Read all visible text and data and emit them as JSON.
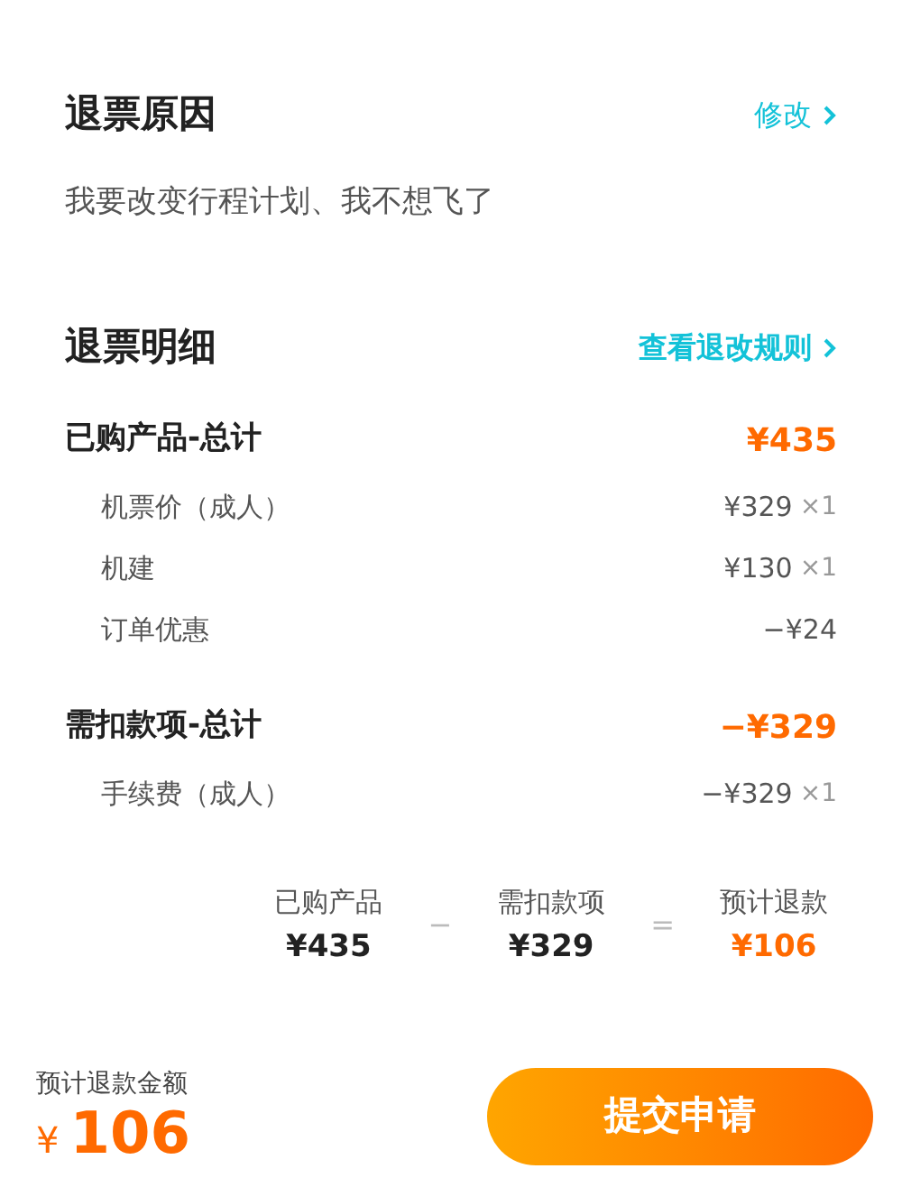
{
  "reason": {
    "title": "退票原因",
    "action": "修改",
    "text": "我要改变行程计划、我不想飞了"
  },
  "details": {
    "title": "退票明细",
    "action": "查看退改规则"
  },
  "groups": [
    {
      "title": "已购产品-总计",
      "total": "¥435",
      "items": [
        {
          "label": "机票价（成人）",
          "amount": "¥329",
          "qty": "×1"
        },
        {
          "label": "机建",
          "amount": "¥130",
          "qty": "×1"
        },
        {
          "label": "订单优惠",
          "amount": "−¥24"
        }
      ]
    },
    {
      "title": "需扣款项-总计",
      "total": "−¥329",
      "items": [
        {
          "label": "手续费（成人）",
          "amount": "−¥329",
          "qty": "×1"
        }
      ]
    }
  ],
  "formula": [
    {
      "kind": "term",
      "label": "已购产品",
      "value": "¥435",
      "highlight": false
    },
    {
      "kind": "op",
      "symbol": "−"
    },
    {
      "kind": "term",
      "label": "需扣款项",
      "value": "¥329",
      "highlight": false
    },
    {
      "kind": "op",
      "symbol": "="
    },
    {
      "kind": "term",
      "label": "预计退款",
      "value": "¥106",
      "highlight": true
    }
  ],
  "footer": {
    "label": "预计退款金额",
    "currency": "¥",
    "amount": "106",
    "button": "提交申请"
  }
}
